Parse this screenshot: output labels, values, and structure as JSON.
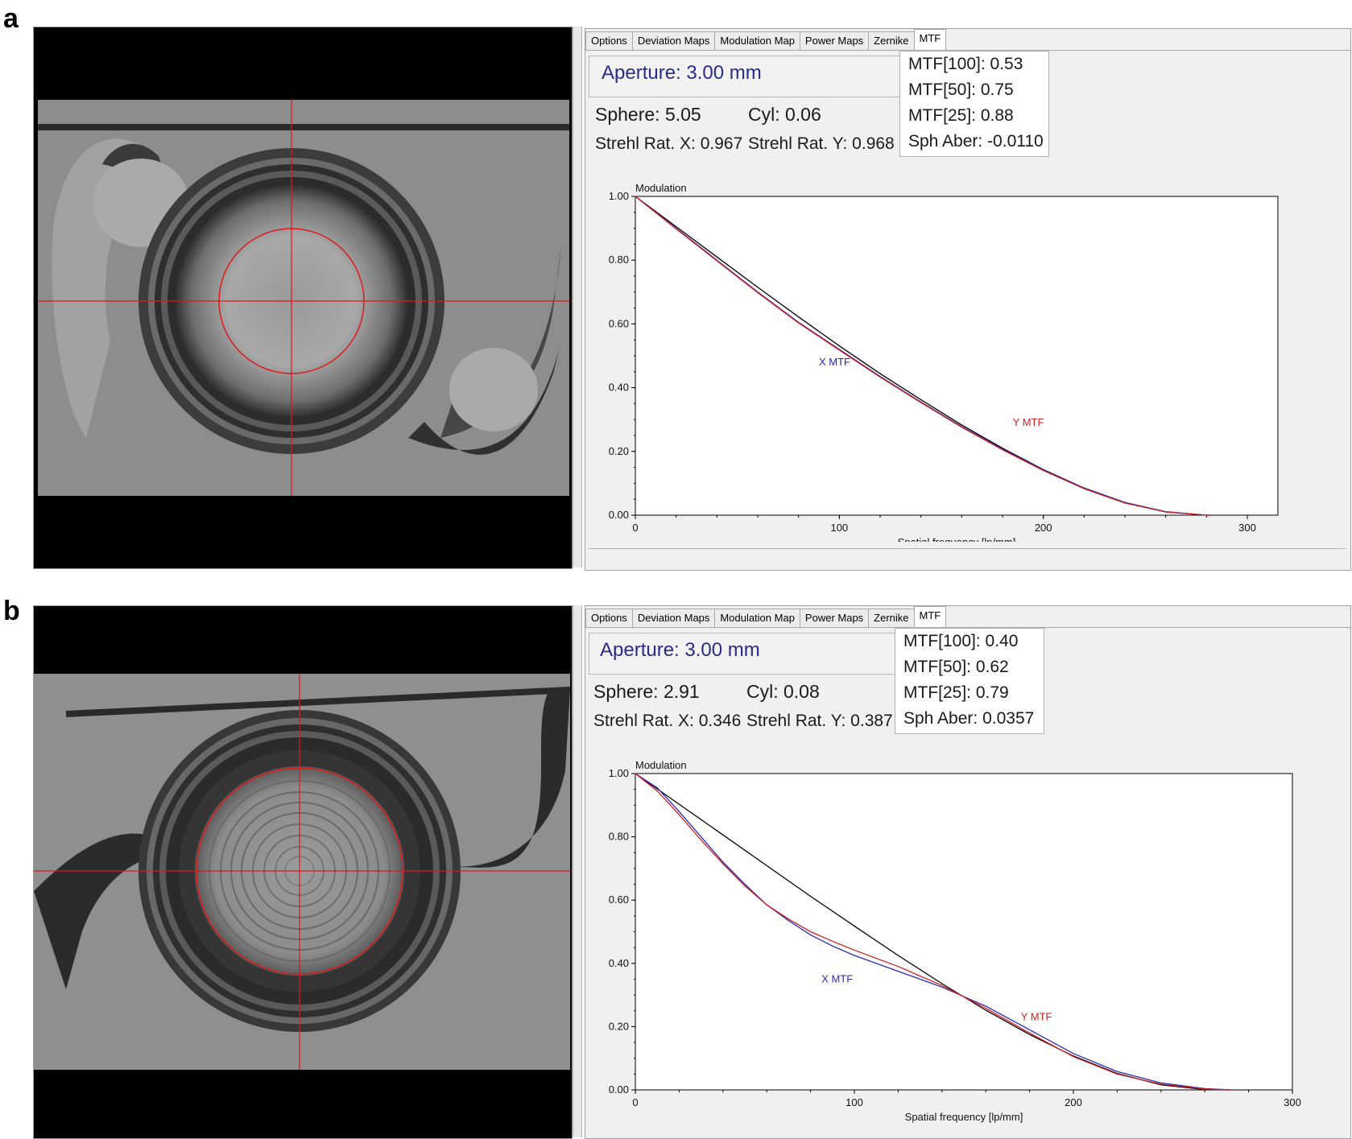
{
  "panels": [
    {
      "letter": "a",
      "tabs": [
        "Options",
        "Deviation Maps",
        "Modulation Map",
        "Power Maps",
        "Zernike",
        "MTF"
      ],
      "active_tab": "MTF",
      "aperture": "Aperture: 3.00 mm",
      "sphere": "Sphere: 5.05",
      "cyl": "Cyl: 0.06",
      "strehl_x": "Strehl Rat. X: 0.967",
      "strehl_y": "Strehl Rat. Y: 0.968",
      "mtf100": "MTF[100]: 0.53",
      "mtf50": "MTF[50]: 0.75",
      "mtf25": "MTF[25]: 0.88",
      "sph_aber": "Sph Aber: -0.0110",
      "photo_style": "smooth"
    },
    {
      "letter": "b",
      "tabs": [
        "Options",
        "Deviation Maps",
        "Modulation Map",
        "Power Maps",
        "Zernike",
        "MTF"
      ],
      "active_tab": "MTF",
      "aperture": "Aperture: 3.00 mm",
      "sphere": "Sphere: 2.91",
      "cyl": "Cyl: 0.08",
      "strehl_x": "Strehl Rat. X: 0.346",
      "strehl_y": "Strehl Rat. Y: 0.387",
      "mtf100": "MTF[100]: 0.40",
      "mtf50": "MTF[50]: 0.62",
      "mtf25": "MTF[25]: 0.79",
      "sph_aber": "Sph Aber: 0.0357",
      "photo_style": "rings"
    }
  ],
  "chart_data": [
    {
      "type": "line",
      "title": "",
      "ylabel": "Modulation",
      "xlabel": "Spatial frequency [lp/mm]",
      "xlim": [
        0,
        315
      ],
      "ylim": [
        0,
        1
      ],
      "xticks": [
        "0",
        "100",
        "200",
        "300"
      ],
      "xtick_values": [
        0,
        100,
        200,
        300
      ],
      "yticks": [
        "0.00",
        "0.20",
        "0.40",
        "0.60",
        "0.80",
        "1.00"
      ],
      "ytick_values": [
        0,
        0.2,
        0.4,
        0.6,
        0.8,
        1.0
      ],
      "grid": false,
      "series": [
        {
          "color": "#000000",
          "x": [
            0,
            20,
            40,
            60,
            80,
            100,
            120,
            140,
            160,
            180,
            200,
            220,
            240,
            260,
            280,
            282
          ],
          "y": [
            1.0,
            0.905,
            0.81,
            0.715,
            0.622,
            0.531,
            0.444,
            0.362,
            0.283,
            0.21,
            0.143,
            0.085,
            0.04,
            0.01,
            0.0,
            0.0
          ]
        },
        {
          "name": "X MTF",
          "color": "#2a2ab8",
          "x": [
            0,
            20,
            40,
            60,
            80,
            100,
            120,
            140,
            160,
            180,
            200,
            220,
            240,
            260,
            280,
            282
          ],
          "y": [
            1.0,
            0.9,
            0.8,
            0.7,
            0.605,
            0.52,
            0.435,
            0.355,
            0.278,
            0.207,
            0.142,
            0.085,
            0.04,
            0.011,
            0.0,
            0.0
          ]
        },
        {
          "name": "Y MTF",
          "color": "#d02020",
          "x": [
            0,
            20,
            40,
            60,
            80,
            100,
            120,
            140,
            160,
            180,
            200,
            220,
            240,
            260,
            280,
            282
          ],
          "y": [
            1.0,
            0.898,
            0.798,
            0.698,
            0.603,
            0.518,
            0.433,
            0.353,
            0.276,
            0.205,
            0.14,
            0.083,
            0.038,
            0.01,
            0.0,
            0.0
          ]
        }
      ],
      "series_labels": [
        {
          "text": "X MTF",
          "color": "#2a2ab8",
          "x": 90,
          "y": 0.47
        },
        {
          "text": "Y MTF",
          "color": "#d02020",
          "x": 185,
          "y": 0.28
        }
      ]
    },
    {
      "type": "line",
      "title": "",
      "ylabel": "Modulation",
      "xlabel": "Spatial frequency [lp/mm]",
      "xlim": [
        0,
        300
      ],
      "ylim": [
        0,
        1
      ],
      "xticks": [
        "0",
        "100",
        "200",
        "300"
      ],
      "xtick_values": [
        0,
        100,
        200,
        300
      ],
      "yticks": [
        "0.00",
        "0.20",
        "0.40",
        "0.60",
        "0.80",
        "1.00"
      ],
      "ytick_values": [
        0,
        0.2,
        0.4,
        0.6,
        0.8,
        1.0
      ],
      "grid": false,
      "series": [
        {
          "color": "#000000",
          "x": [
            0,
            20,
            40,
            60,
            80,
            100,
            120,
            140,
            160,
            180,
            200,
            220,
            240,
            260,
            272
          ],
          "y": [
            1.0,
            0.903,
            0.806,
            0.709,
            0.612,
            0.518,
            0.425,
            0.336,
            0.252,
            0.175,
            0.107,
            0.052,
            0.016,
            0.001,
            0.0
          ]
        },
        {
          "name": "X MTF",
          "color": "#2a2ab8",
          "x": [
            0,
            10,
            20,
            30,
            40,
            50,
            60,
            70,
            80,
            90,
            100,
            120,
            140,
            160,
            180,
            200,
            220,
            240,
            260,
            272
          ],
          "y": [
            1.0,
            0.955,
            0.88,
            0.8,
            0.72,
            0.65,
            0.585,
            0.535,
            0.49,
            0.455,
            0.425,
            0.375,
            0.325,
            0.265,
            0.19,
            0.115,
            0.058,
            0.022,
            0.004,
            0.0
          ]
        },
        {
          "name": "Y MTF",
          "color": "#d02020",
          "x": [
            0,
            10,
            20,
            30,
            40,
            50,
            60,
            70,
            80,
            90,
            100,
            120,
            140,
            160,
            180,
            200,
            220,
            240,
            260,
            272
          ],
          "y": [
            1.0,
            0.945,
            0.87,
            0.79,
            0.715,
            0.645,
            0.585,
            0.54,
            0.5,
            0.47,
            0.442,
            0.39,
            0.33,
            0.258,
            0.18,
            0.105,
            0.05,
            0.018,
            0.003,
            0.0
          ]
        }
      ],
      "series_labels": [
        {
          "text": "X MTF",
          "color": "#2a2ab8",
          "x": 85,
          "y": 0.34
        },
        {
          "text": "Y MTF",
          "color": "#d02020",
          "x": 176,
          "y": 0.22
        }
      ]
    }
  ]
}
